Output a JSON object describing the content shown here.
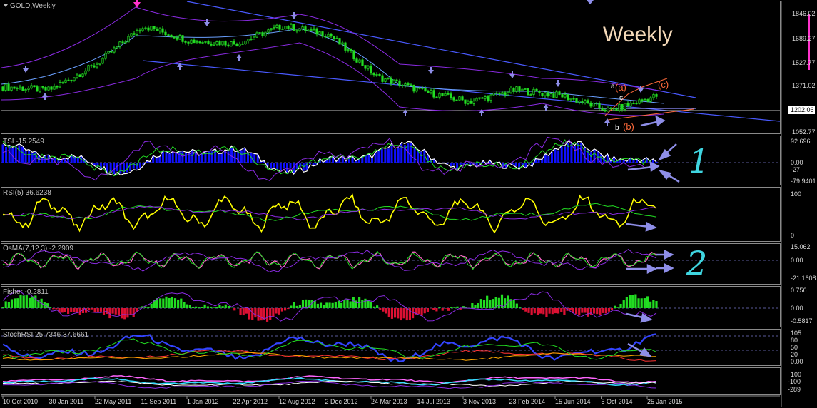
{
  "window": {
    "title": "GOLD,Weekly",
    "menu_icon": "dropdown-triangle-icon"
  },
  "annotations": {
    "title": "Weekly",
    "wave_a_paren": "(a)",
    "wave_b_paren": "(b)",
    "wave_c_paren": "(c)",
    "wave_a": "a",
    "wave_b": "b",
    "wave_c": "c",
    "marker_1": "1",
    "marker_2": "2"
  },
  "colors": {
    "bull_candle": "#22dd22",
    "channel": "#4a5aff",
    "envelope": "#8a2be2",
    "tsi_hist": "#1010ff",
    "rsi_line": "#ffff00",
    "fisher_pos": "#22dd22",
    "fisher_neg": "#dd1133",
    "arrow": "#8e8ee8",
    "accent_cyan": "#3fd5e0"
  },
  "chart_data": [
    {
      "type": "candlestick",
      "title": "GOLD,Weekly",
      "price_labels": [
        "1846.02",
        "1689.27",
        "1527.77",
        "1371.02",
        "1202.06",
        "1052.77"
      ],
      "current_price": "1202.06",
      "ylim": [
        1052.77,
        1846.02
      ],
      "x": [
        "10 Oct 2010",
        "30 Jan 2011",
        "22 May 2011",
        "11 Sep 2011",
        "1 Jan 2012",
        "22 Apr 2012",
        "12 Aug 2012",
        "2 Dec 2012",
        "24 Mar 2013",
        "14 Jul 2013",
        "3 Nov 2013",
        "23 Feb 2014",
        "15 Jun 2014",
        "5 Oct 2014",
        "25 Jan 2015"
      ],
      "close": [
        1350,
        1330,
        1500,
        1760,
        1660,
        1640,
        1760,
        1700,
        1420,
        1320,
        1250,
        1330,
        1290,
        1190,
        1290
      ]
    },
    {
      "type": "line",
      "title": "TSI -15.2549",
      "axis_labels": [
        "92.696",
        "0.00",
        "-27",
        "-79.9401"
      ],
      "ylim": [
        -79.9401,
        92.696
      ]
    },
    {
      "type": "line",
      "title": "RSI(5) 36.6238",
      "axis_labels": [
        "100",
        "0"
      ],
      "ylim": [
        0,
        100
      ]
    },
    {
      "type": "line",
      "title": "OsMA(7,12,3) -2.2909",
      "axis_labels": [
        "15.062",
        "0.00",
        "-21.1608"
      ],
      "ylim": [
        -21.1608,
        15.062
      ]
    },
    {
      "type": "bar",
      "title": "Fisher -0.2811",
      "axis_labels": [
        "0.756",
        "0.00",
        "-0.5817"
      ],
      "ylim": [
        -0.5817,
        0.756
      ]
    },
    {
      "type": "line",
      "title": "StochRSI 25.7346 37.6661",
      "axis_labels": [
        "105",
        "80",
        "50",
        "20",
        "0.00"
      ],
      "ylim": [
        0,
        105
      ]
    },
    {
      "type": "line",
      "title": "",
      "axis_labels": [
        "100",
        "-100",
        "-289"
      ],
      "ylim": [
        -289,
        100
      ]
    }
  ]
}
